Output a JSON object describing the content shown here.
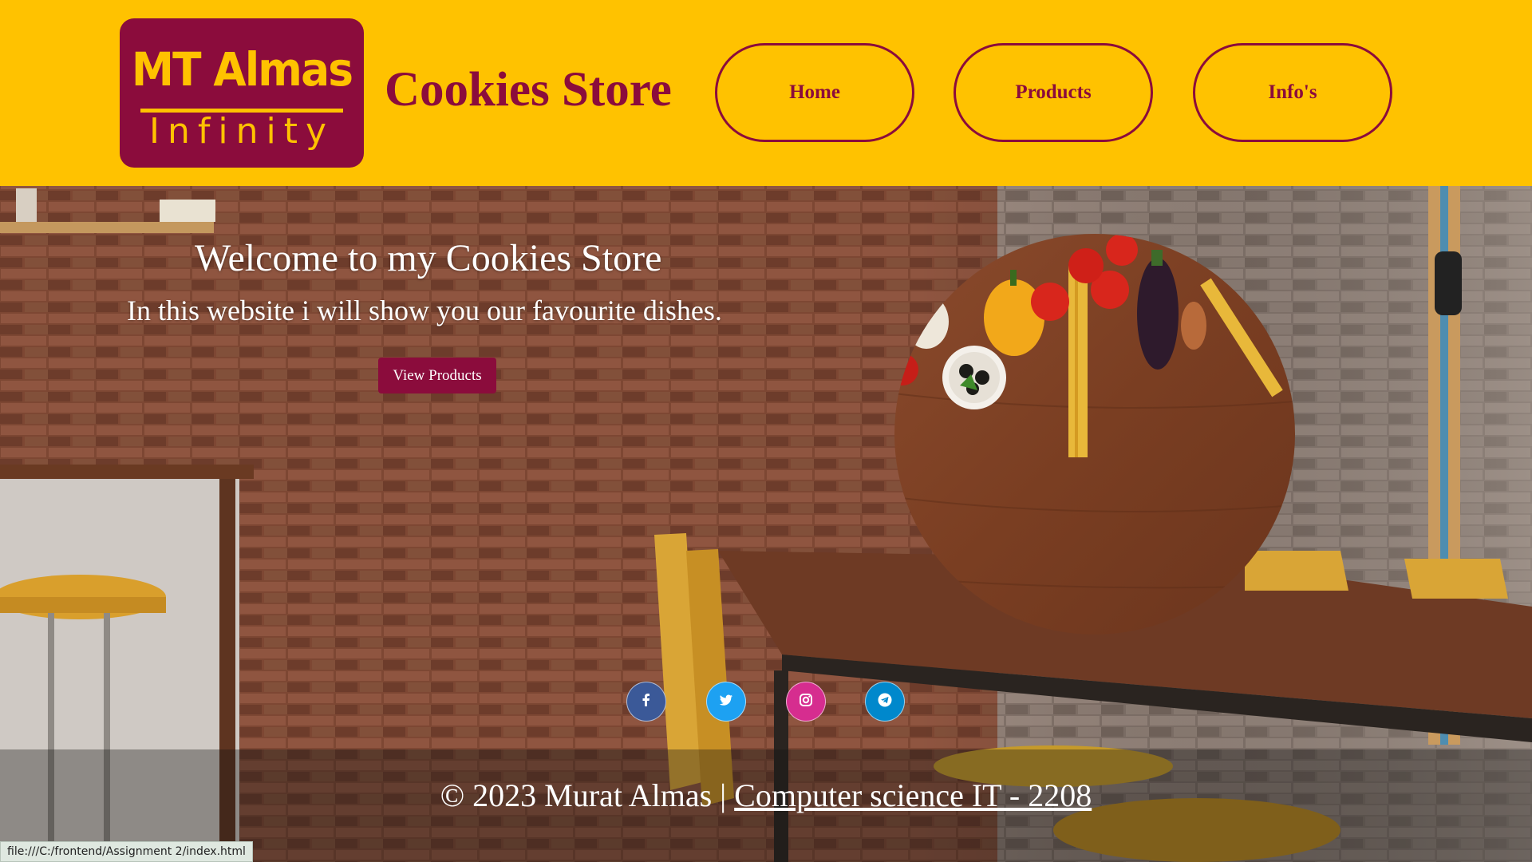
{
  "header": {
    "logo": {
      "line1": "MT Almas",
      "line2": "Infinity"
    },
    "title": "Cookies Store",
    "nav": [
      {
        "label": "Home"
      },
      {
        "label": "Products"
      },
      {
        "label": "Info's"
      }
    ]
  },
  "hero": {
    "heading": "Welcome to my Cookies Store",
    "subheading": "In this website i will show you our favourite dishes.",
    "button_label": "View Products"
  },
  "social": [
    {
      "icon": "facebook-icon",
      "color": "#3b5998"
    },
    {
      "icon": "twitter-icon",
      "color": "#1da1f2"
    },
    {
      "icon": "instagram-icon",
      "color": "#d62d8f"
    },
    {
      "icon": "telegram-icon",
      "color": "#0088cc"
    }
  ],
  "footer": {
    "copyright": "© 2023 Murat Almas | ",
    "link_text": "Computer science IT - 2208"
  },
  "status_bar": {
    "url": "file:///C:/frontend/Assignment 2/index.html"
  },
  "colors": {
    "header_bg": "#ffc200",
    "brand": "#8b0c3c"
  }
}
